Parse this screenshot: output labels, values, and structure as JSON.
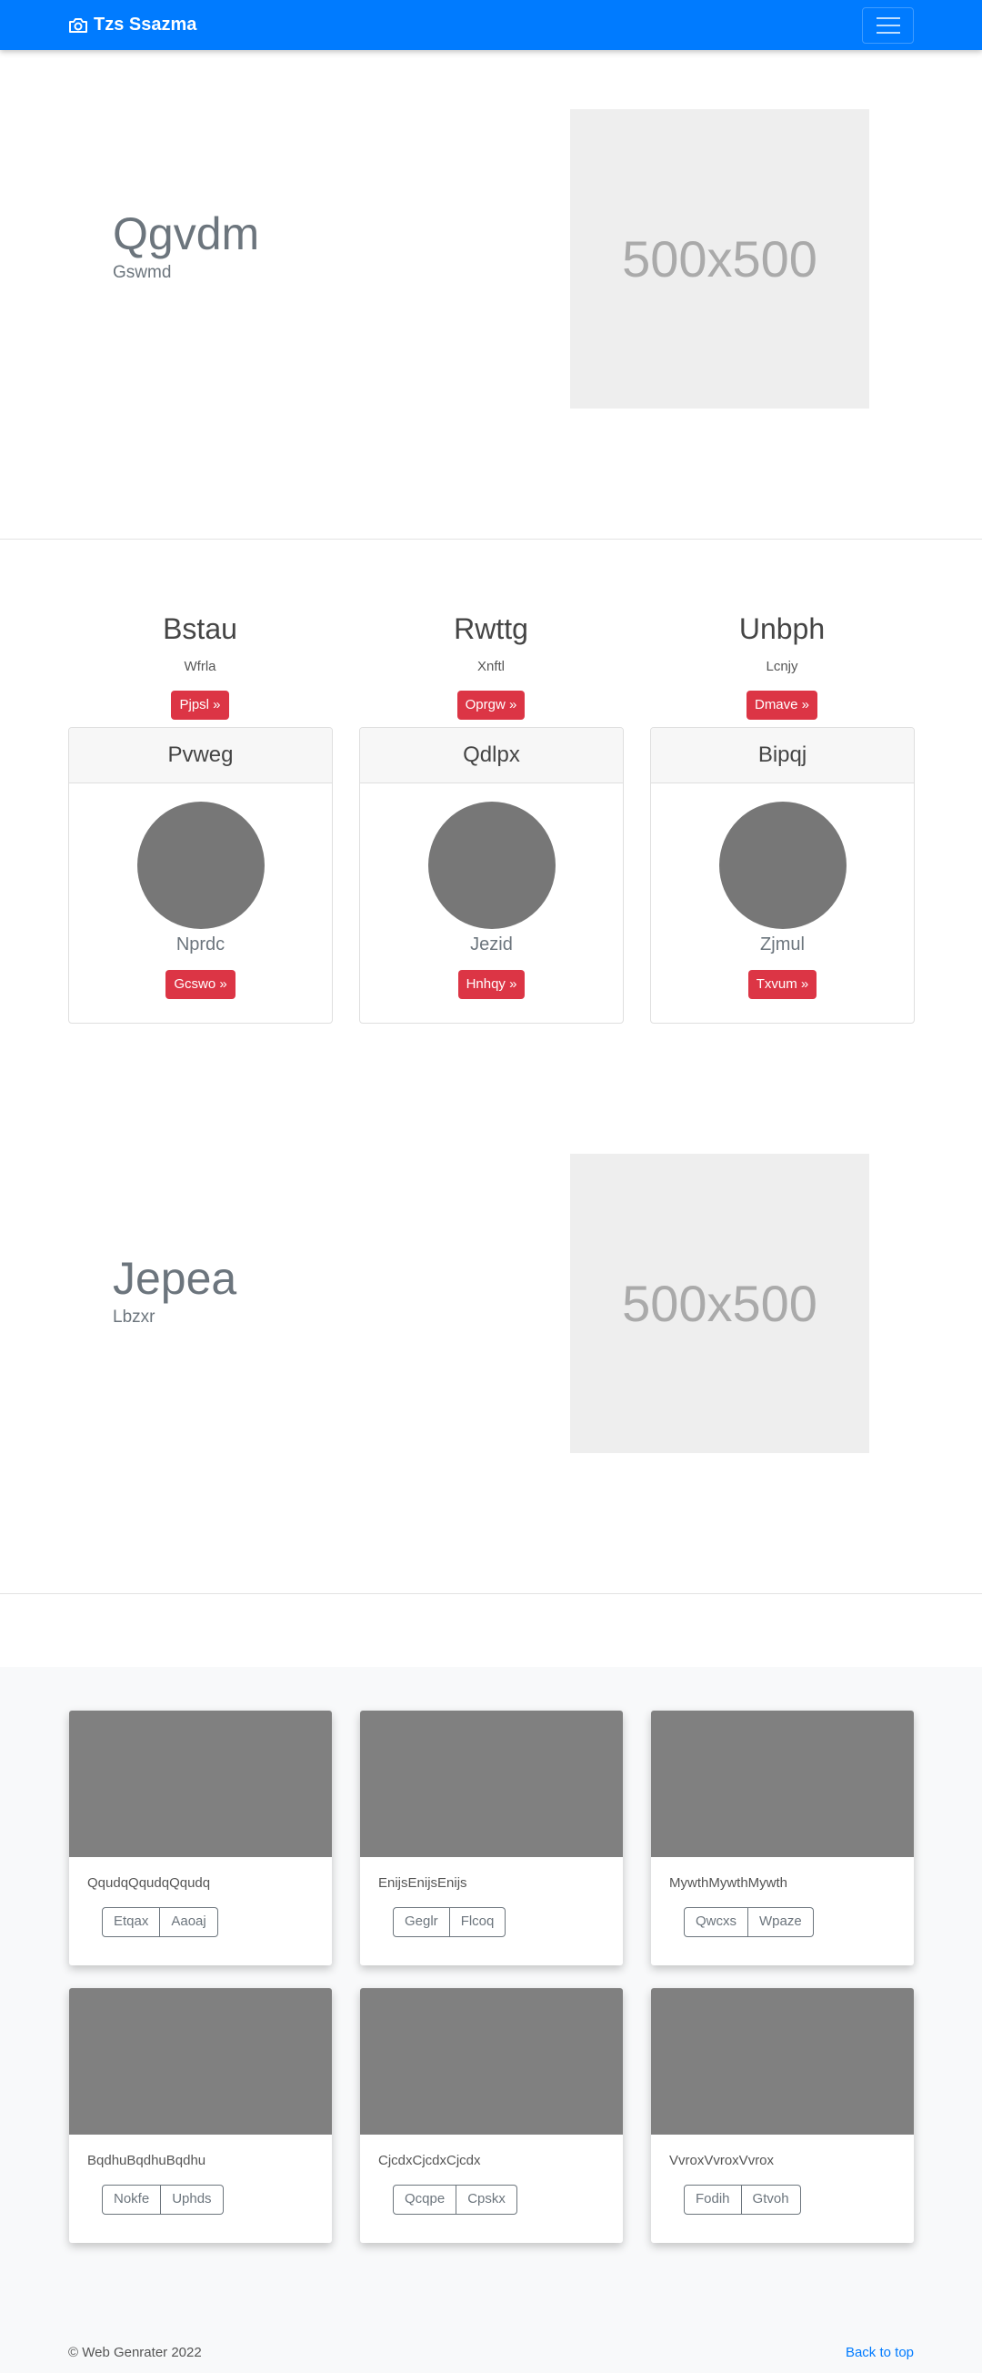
{
  "navbar": {
    "brand": "Tzs Ssazma",
    "brand_icon": "camera-icon",
    "toggler_icon": "hamburger-menu-icon",
    "color": "#007bff"
  },
  "hero1": {
    "title": "Qgvdm",
    "subtitle": "Gswmd",
    "image_text": "500x500"
  },
  "features": {
    "columns": [
      {
        "heading": "Bstau",
        "text": "Wfrla",
        "button": "Pjpsl »"
      },
      {
        "heading": "Rwttg",
        "text": "Xnftl",
        "button": "Oprgw »"
      },
      {
        "heading": "Unbph",
        "text": "Lcnjy",
        "button": "Dmave »"
      }
    ],
    "cards": [
      {
        "header": "Pvweg",
        "name": "Nprdc",
        "button": "Gcswo »"
      },
      {
        "header": "Qdlpx",
        "name": "Jezid",
        "button": "Hnhqy »"
      },
      {
        "header": "Bipqj",
        "name": "Zjmul",
        "button": "Txvum »"
      }
    ]
  },
  "hero2": {
    "title": "Jepea",
    "subtitle": "Lbzxr",
    "image_text": "500x500"
  },
  "album": {
    "cards": [
      {
        "text": "QqudqQqudqQqudq",
        "btn1": "Etqax",
        "btn2": "Aaoaj"
      },
      {
        "text": "EnijsEnijsEnijs",
        "btn1": "Geglr",
        "btn2": "Flcoq"
      },
      {
        "text": "MywthMywthMywth",
        "btn1": "Qwcxs",
        "btn2": "Wpaze"
      },
      {
        "text": "BqdhuBqdhuBqdhu",
        "btn1": "Nokfe",
        "btn2": "Uphds"
      },
      {
        "text": "CjcdxCjcdxCjcdx",
        "btn1": "Qcqpe",
        "btn2": "Cpskx"
      },
      {
        "text": "VvroxVvroxVvrox",
        "btn1": "Fodih",
        "btn2": "Gtvoh"
      }
    ]
  },
  "footer": {
    "copyright": "© Web Genrater 2022",
    "back_to_top": "Back to top"
  }
}
